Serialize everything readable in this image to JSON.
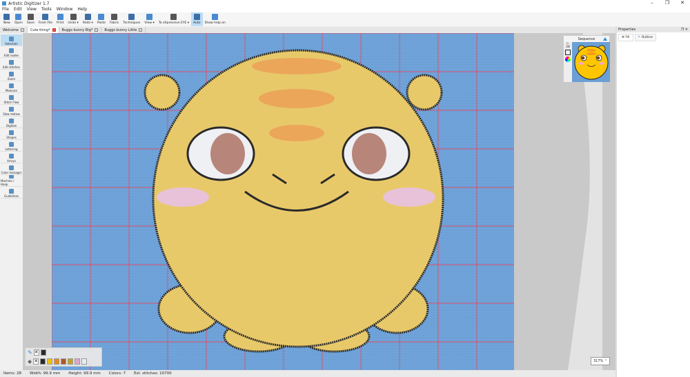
{
  "window": {
    "title": "Artistic Digitizer 1.7",
    "controls": [
      "–",
      "❐",
      "✕"
    ]
  },
  "menu": [
    "File",
    "Edit",
    "View",
    "Tools",
    "Window",
    "Help"
  ],
  "toolbar": [
    {
      "label": "New",
      "icon": "new-document-icon"
    },
    {
      "label": "Open",
      "icon": "open-folder-icon"
    },
    {
      "label": "Save",
      "icon": "save-icon"
    },
    {
      "label": "From File",
      "icon": "import-file-icon"
    },
    {
      "label": "Print",
      "icon": "print-icon"
    },
    {
      "label": "Undo ▾",
      "icon": "undo-icon"
    },
    {
      "label": "Redo ▾",
      "icon": "redo-icon"
    },
    {
      "label": "Paste",
      "icon": "paste-icon"
    },
    {
      "label": "Fabric",
      "icon": "fabric-icon"
    },
    {
      "label": "Techniques",
      "icon": "techniques-icon"
    },
    {
      "label": "View ▾",
      "icon": "view-icon"
    },
    {
      "label": "To eXpressive EYE ▾",
      "icon": "machine-icon"
    },
    {
      "label": "Auto",
      "icon": "auto-icon",
      "active": true
    },
    {
      "label": "Show help on",
      "icon": "help-icon"
    }
  ],
  "tabs": [
    {
      "label": "Welcome",
      "active": false
    },
    {
      "label": "Cute thing*",
      "active": true
    },
    {
      "label": "Buggs bunny Big*",
      "active": false
    },
    {
      "label": "Buggs bunny Little",
      "active": false
    }
  ],
  "tools": [
    {
      "label": "Selection",
      "active": true
    },
    {
      "label": "Edit nodes"
    },
    {
      "label": "Edit stitches"
    },
    {
      "label": "Zoom"
    },
    {
      "label": "Measure"
    },
    {
      "label": "Stitch Flow"
    },
    {
      "label": "Slow redraw"
    },
    {
      "label": "Digitize"
    },
    {
      "label": "Shapes"
    },
    {
      "label": "Lettering"
    },
    {
      "label": "Arrays"
    },
    {
      "label": "Color manager"
    },
    {
      "label": "Machine / Hoop"
    },
    {
      "label": "Guidelines"
    }
  ],
  "sequence": {
    "title": "Sequence",
    "count": "28"
  },
  "zoom": "317%",
  "palette": {
    "row1": [
      "#222222"
    ],
    "row2": [
      "#222222",
      "#f2c200",
      "#f08a10",
      "#b5541c",
      "#c9a21a",
      "#e4a8cf",
      "#f2f2f2"
    ]
  },
  "status": {
    "items": "Items: 28",
    "width": "Width: 99.9 mm",
    "height": "Height: 99.9 mm",
    "colors": "Colors: 7",
    "stitches": "Est. stitches: 10700"
  },
  "properties": {
    "title": "Properties",
    "tabs": [
      "Fill",
      "Outline"
    ]
  }
}
